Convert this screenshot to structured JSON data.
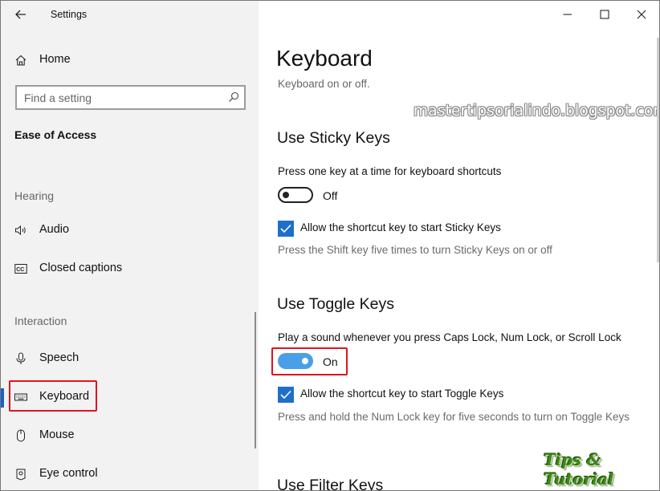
{
  "window": {
    "app_title": "Settings"
  },
  "sidebar": {
    "home_label": "Home",
    "search_placeholder": "Find a setting",
    "section_title": "Ease of Access",
    "groups": {
      "hearing": "Hearing",
      "interaction": "Interaction"
    },
    "items": {
      "audio": "Audio",
      "closed_captions": "Closed captions",
      "speech": "Speech",
      "keyboard": "Keyboard",
      "mouse": "Mouse",
      "eye_control": "Eye control"
    },
    "selected_item": "Keyboard"
  },
  "main": {
    "title": "Keyboard",
    "subtitle": "Keyboard on or off.",
    "watermark": "mastertipsorialindo.blogspot.com",
    "sticky_keys": {
      "heading": "Use Sticky Keys",
      "description": "Press one key at a time for keyboard shortcuts",
      "toggle_state": "Off",
      "checkbox_label": "Allow the shortcut key to start Sticky Keys",
      "checkbox_checked": true,
      "hint": "Press the Shift key five times to turn Sticky Keys on or off"
    },
    "toggle_keys": {
      "heading": "Use Toggle Keys",
      "description": "Play a sound whenever you press Caps Lock, Num Lock, or Scroll Lock",
      "toggle_state": "On",
      "checkbox_label": "Allow the shortcut key to start Toggle Keys",
      "checkbox_checked": true,
      "hint": "Press and hold the Num Lock key for five seconds to turn on Toggle Keys"
    },
    "filter_keys": {
      "heading": "Use Filter Keys"
    },
    "brand_logo": "Tips & Tutorial"
  },
  "colors": {
    "accent": "#1e6fc8",
    "toggle_on": "#4aa0e6",
    "highlight_box": "#e0141e",
    "sidebar_bg": "#f2f2f2"
  },
  "icons": {
    "back": "back-arrow-icon",
    "home": "home-icon",
    "search": "search-icon",
    "audio": "speaker-icon",
    "closed_captions": "cc-icon",
    "speech": "microphone-icon",
    "keyboard": "keyboard-icon",
    "mouse": "mouse-icon",
    "eye_control": "eye-control-icon",
    "minimize": "minimize-icon",
    "maximize": "maximize-icon",
    "close": "close-icon",
    "checkbox": "checkmark-icon"
  }
}
